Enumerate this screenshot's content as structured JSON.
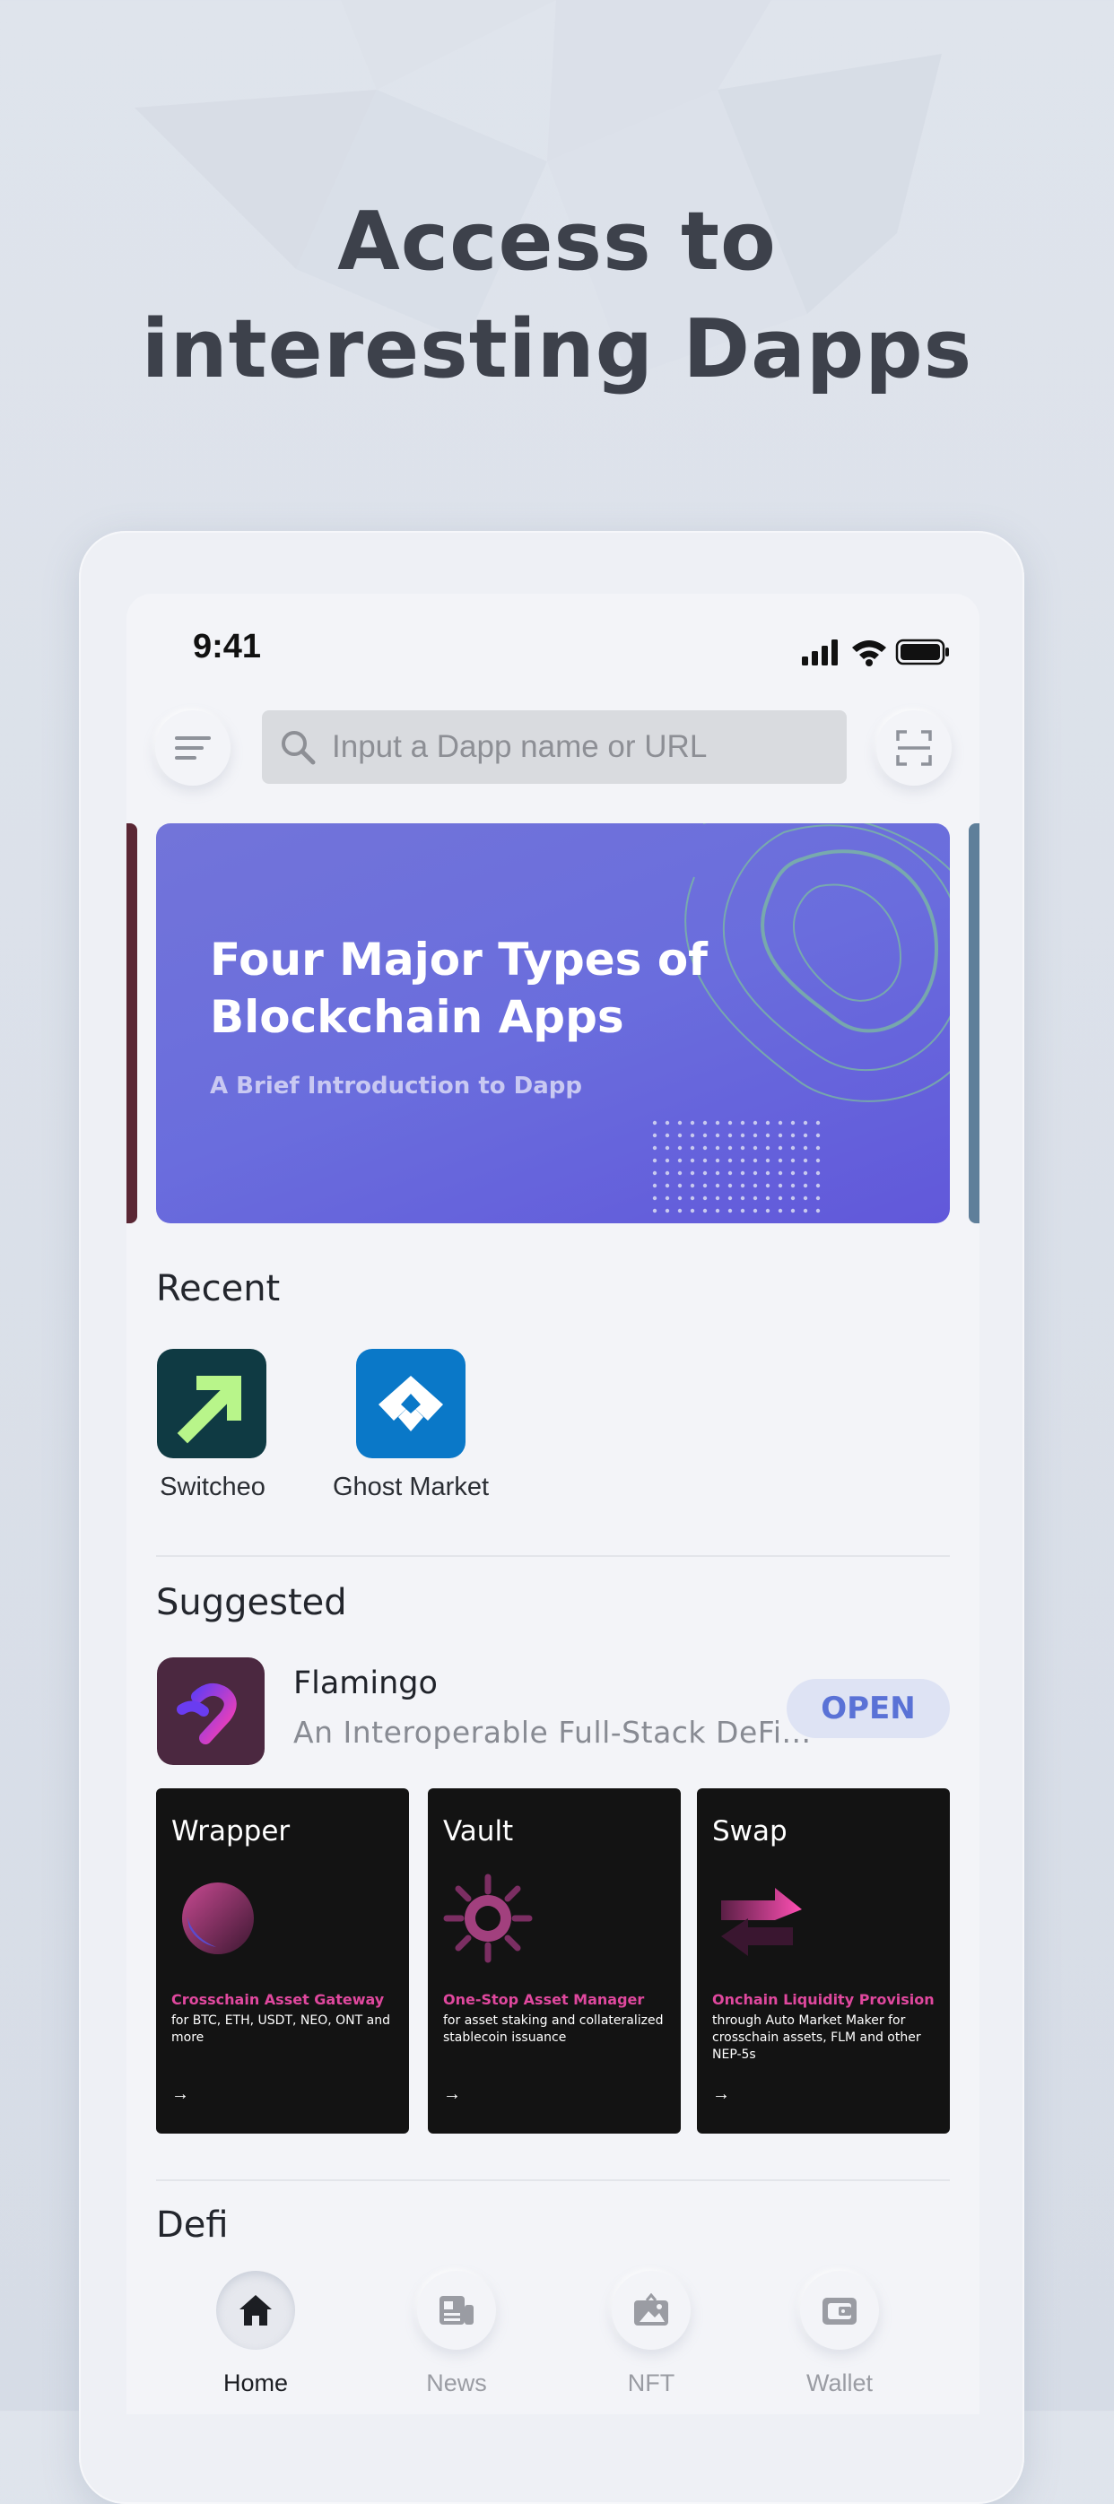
{
  "headline": {
    "line1": "Access to",
    "line2": "interesting Dapps"
  },
  "status_bar": {
    "time": "9:41"
  },
  "search": {
    "placeholder": "Input a Dapp name or URL"
  },
  "banner": {
    "title": "Four Major Types of Blockchain Apps",
    "subtitle": "A Brief Introduction to Dapp"
  },
  "recent": {
    "title": "Recent",
    "apps": [
      {
        "name": "Switcheo",
        "color": "#0f3a43",
        "accent": "#b8f58a"
      },
      {
        "name": "Ghost Market",
        "color": "#0a78c8",
        "accent": "#ffffff"
      }
    ]
  },
  "suggested": {
    "title": "Suggested",
    "app": {
      "name": "Flamingo",
      "description": "An Interoperable Full-Stack DeFi...",
      "action": "OPEN",
      "color": "#4b2840"
    },
    "cards": [
      {
        "title": "Wrapper",
        "tag": "Crosschain Asset Gateway",
        "description": "for BTC, ETH, USDT, NEO, ONT and more",
        "arrow": "→"
      },
      {
        "title": "Vault",
        "tag": "One-Stop Asset Manager",
        "description": "for asset staking and collateralized stablecoin issuance",
        "arrow": "→"
      },
      {
        "title": "Swap",
        "tag": "Onchain Liquidity Provision",
        "description": "through Auto Market Maker for crosschain assets, FLM and other NEP-5s",
        "arrow": "→"
      }
    ]
  },
  "defi": {
    "title": "Defi"
  },
  "tabbar": {
    "items": [
      {
        "label": "Home",
        "icon": "home-icon",
        "active": true
      },
      {
        "label": "News",
        "icon": "news-icon",
        "active": false
      },
      {
        "label": "NFT",
        "icon": "nft-icon",
        "active": false
      },
      {
        "label": "Wallet",
        "icon": "wallet-icon",
        "active": false
      }
    ]
  },
  "colors": {
    "accent": "#5a72d6",
    "banner": "#6a6ddd",
    "card_tag": "#e0489e",
    "text_dark": "#23262d"
  }
}
